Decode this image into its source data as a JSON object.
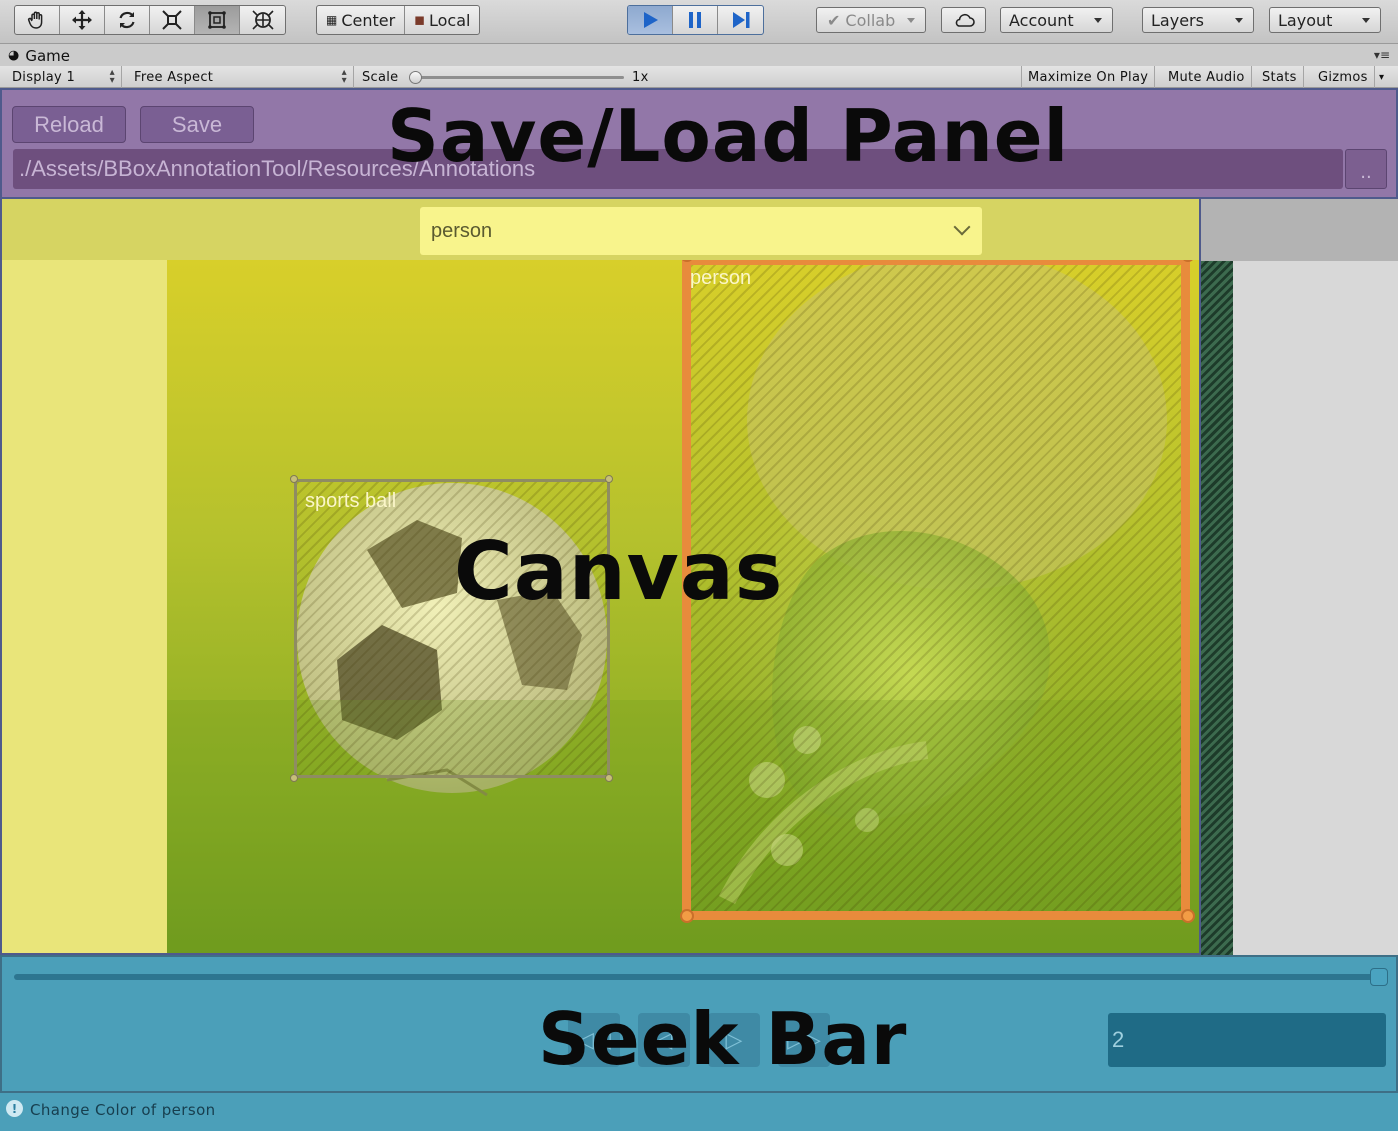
{
  "toolbar": {
    "tools": [
      "hand-tool",
      "move-tool",
      "rotate-tool",
      "scale-tool",
      "rect-tool",
      "transform-tool"
    ],
    "pivot_label": "Center",
    "space_label": "Local",
    "collab_label": "Collab",
    "account_label": "Account",
    "layers_label": "Layers",
    "layout_label": "Layout"
  },
  "game_view": {
    "tab_title": "Game",
    "display": "Display 1",
    "aspect": "Free Aspect",
    "scale_label": "Scale",
    "scale_value": "1x",
    "maximize_on_play": "Maximize On Play",
    "mute_audio": "Mute Audio",
    "stats": "Stats",
    "gizmos": "Gizmos"
  },
  "save_panel": {
    "reload_label": "Reload",
    "save_label": "Save",
    "path": "./Assets/BBoxAnnotationTool/Resources/Annotations",
    "browse_label": "..",
    "overlay_title": "Save/Load Panel"
  },
  "canvas": {
    "selected_label": "person",
    "overlay_title": "Canvas",
    "boxes": [
      {
        "label": "sports ball",
        "color": "#8f8c63"
      },
      {
        "label": "person",
        "color": "#e88b3c"
      }
    ]
  },
  "seek_bar": {
    "overlay_title": "Seek Bar",
    "frame_value": "2",
    "progress": 1.0
  },
  "status": {
    "message": "Change Color of person"
  },
  "colors": {
    "save_panel_bg": "#9277a8",
    "canvas_bg": "#e9e57a",
    "seek_bg": "#4b9fb9",
    "bbox_person": "#e88b3c"
  }
}
